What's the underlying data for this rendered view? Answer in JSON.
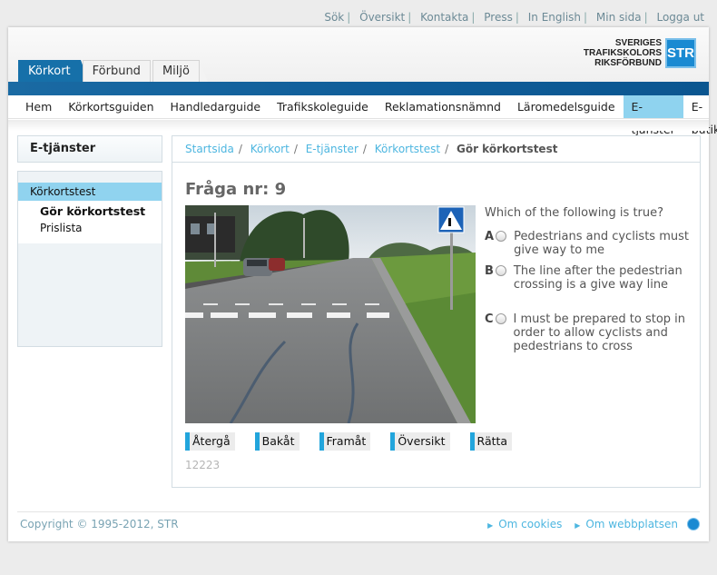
{
  "top_links": [
    "Sök",
    "Översikt",
    "Kontakta",
    "Press",
    "In English",
    "Min sida",
    "Logga ut"
  ],
  "tabs": [
    "Körkort",
    "Förbund",
    "Miljö"
  ],
  "logo": {
    "line1": "SVERIGES",
    "line2": "TRAFIKSKOLORS",
    "line3": "RIKSFÖRBUND",
    "mark": "STR"
  },
  "main_nav": [
    "Hem",
    "Körkortsguiden",
    "Handledarguide",
    "Trafikskoleguide",
    "Reklamationsnämnd",
    "Läromedelsguide",
    "E-tjänster",
    "E-butik"
  ],
  "sidebar": {
    "title": "E-tjänster",
    "items": [
      {
        "label": "Körkortstest"
      },
      {
        "label": "Gör körkortstest"
      },
      {
        "label": "Prislista"
      }
    ]
  },
  "breadcrumbs": [
    "Startsida",
    "Körkort",
    "E-tjänster",
    "Körkortstest",
    "Gör körkortstest"
  ],
  "question": {
    "title": "Fråga nr: 9",
    "text": "Which of the following is true?",
    "answers": [
      {
        "letter": "A",
        "text": "Pedestrians and cyclists must give way to me"
      },
      {
        "letter": "B",
        "text": "The line after the pedestrian crossing is a give way line"
      },
      {
        "letter": "C",
        "text": "I must be prepared to stop in order to allow cyclists and pedestrians to cross"
      }
    ],
    "buttons": [
      "Återgå",
      "Bakåt",
      "Framåt",
      "Översikt",
      "Rätta"
    ],
    "id": "12223"
  },
  "footer": {
    "copyright": "Copyright © 1995-2012, STR",
    "links": [
      "Om cookies",
      "Om webbplatsen"
    ]
  },
  "colors": {
    "brand_blue": "#1670a9",
    "nav_highlight": "#8fd3ef",
    "link": "#4db6e0"
  }
}
